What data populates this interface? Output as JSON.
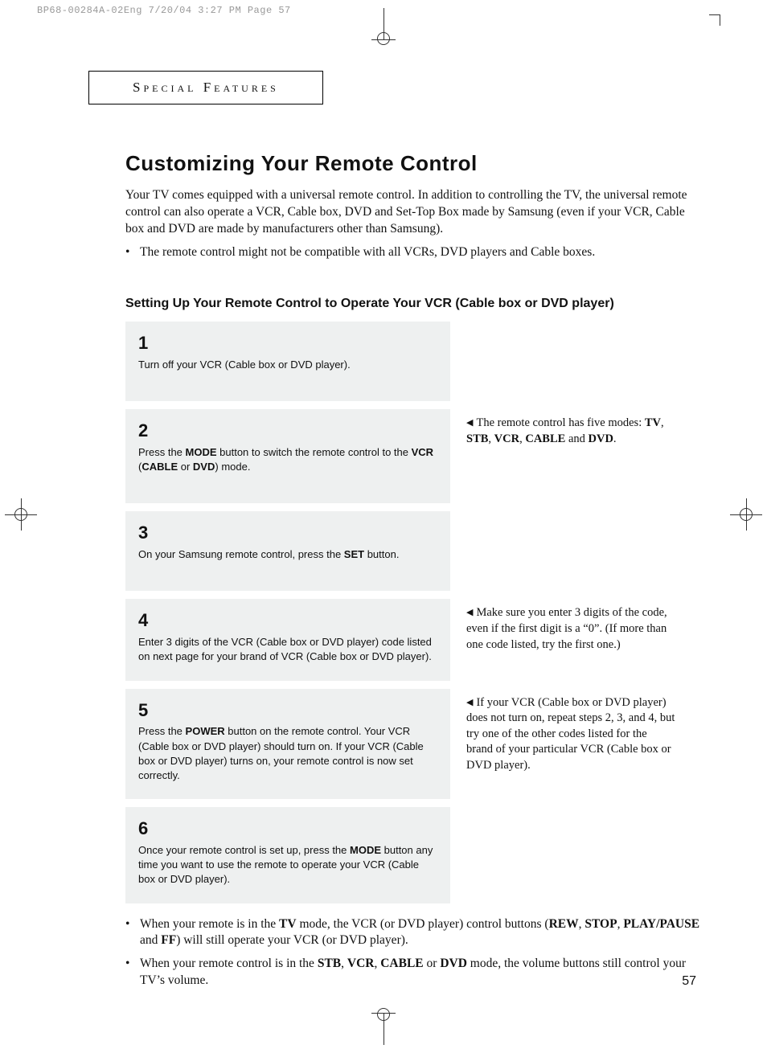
{
  "print_header": "BP68-00284A-02Eng  7/20/04  3:27 PM  Page 57",
  "section_label": "Special Features",
  "title": "Customizing Your Remote Control",
  "intro": "Your TV comes equipped with a universal remote control. In addition to controlling the TV, the universal remote control can also operate a VCR, Cable box, DVD and Set-Top Box made by Samsung (even if your VCR, Cable box and DVD are made by manufacturers other than Samsung).",
  "intro_bullet": "The remote control might not be compatible with all VCRs, DVD players and Cable boxes.",
  "subtitle": "Setting Up Your Remote Control to Operate Your VCR (Cable box or DVD player)",
  "steps": [
    {
      "num": "1",
      "text_before": "Turn off your VCR (Cable box or DVD player).",
      "aside": ""
    },
    {
      "num": "2",
      "text_before": "Press the ",
      "kw1": "MODE",
      "text_mid1": " button to switch the remote control to the ",
      "kw2": "VCR",
      "text_mid2": " (",
      "kw3": "CABLE",
      "text_mid3": " or ",
      "kw4": "DVD",
      "text_after": ") mode.",
      "aside_plain1": "The remote control has five modes: ",
      "aside_b1": "TV",
      "aside_sep1": ", ",
      "aside_b2": "STB",
      "aside_sep2": ", ",
      "aside_b3": "VCR",
      "aside_sep3": ", ",
      "aside_b4": "CABLE",
      "aside_sep4": " and ",
      "aside_b5": "DVD",
      "aside_end": "."
    },
    {
      "num": "3",
      "text_before": "On your Samsung remote control, press the ",
      "kw1": "SET",
      "text_after": " button."
    },
    {
      "num": "4",
      "text_before": "Enter 3 digits of the VCR (Cable box or DVD player) code listed on next page for your brand of VCR (Cable box or DVD player).",
      "aside_plain1": "Make sure you enter 3 digits of the code, even if the first digit is a “0”. (If more than one code listed, try the first one.)"
    },
    {
      "num": "5",
      "text_before": "Press the ",
      "kw1": "POWER",
      "text_after": " button on the remote control. Your VCR (Cable box or DVD player) should turn on. If your VCR (Cable box or DVD player) turns on, your remote control is now set correctly.",
      "aside_plain1": "If your VCR (Cable box or DVD player) does not turn on, repeat steps 2, 3, and 4, but try one of the other codes listed for the brand of your particular VCR (Cable box or DVD player)."
    },
    {
      "num": "6",
      "text_before": "Once your remote control is set up, press the ",
      "kw1": "MODE",
      "text_after": " button any time you want to use the remote to operate your VCR (Cable box or DVD player)."
    }
  ],
  "footer_bullets": [
    {
      "pre": "When your remote is in the ",
      "b1": "TV",
      "mid1": " mode, the VCR (or DVD player) control buttons (",
      "b2": "REW",
      "mid2": ", ",
      "b3": "STOP",
      "mid3": ", ",
      "b4": "PLAY/PAUSE",
      "mid4": " and ",
      "b5": "FF",
      "post": ") will still operate your VCR (or DVD player)."
    },
    {
      "pre": "When your remote control is in the ",
      "b1": "STB",
      "mid1": ", ",
      "b2": "VCR",
      "mid2": ", ",
      "b3": "CABLE",
      "mid3": " or ",
      "b4": "DVD",
      "post": " mode, the volume buttons still control your TV’s volume."
    }
  ],
  "page_number": "57"
}
